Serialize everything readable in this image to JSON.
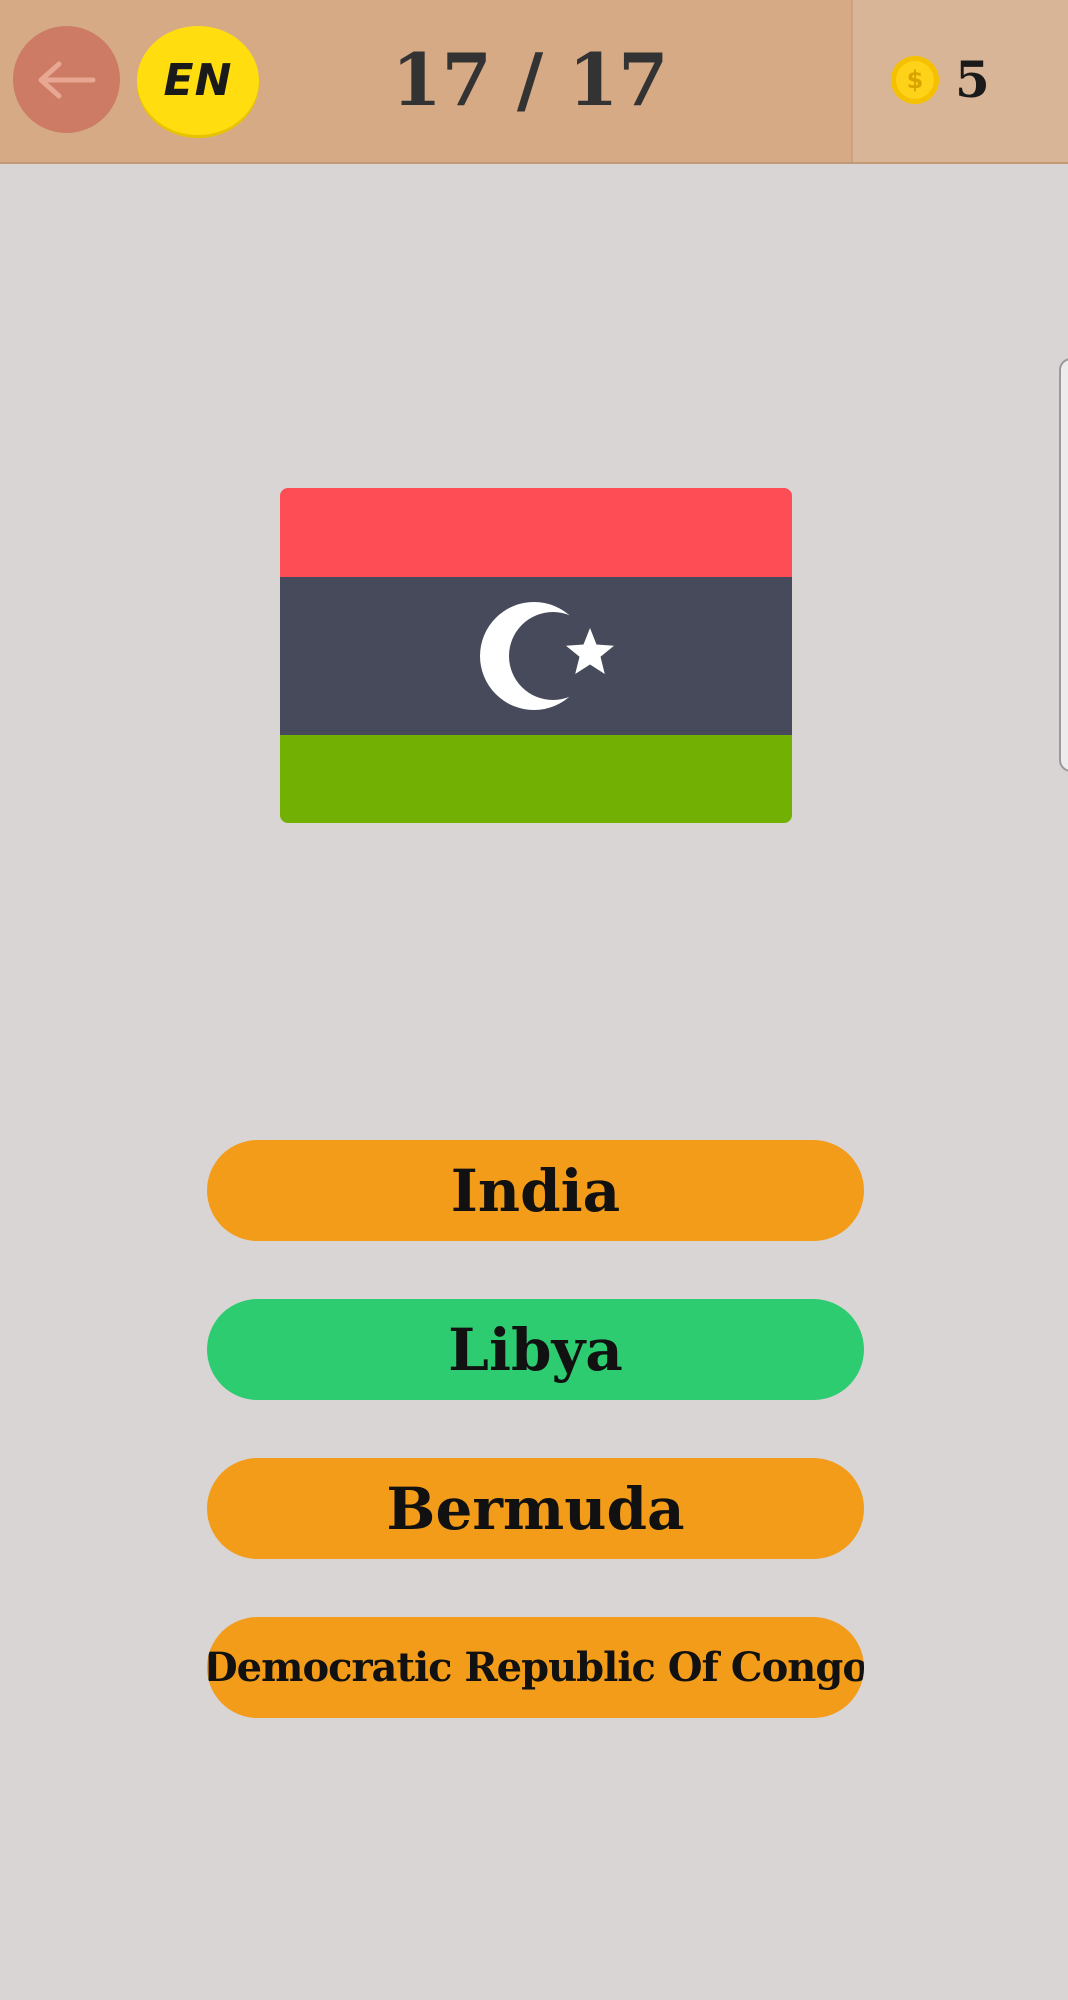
{
  "header": {
    "language_label": "EN",
    "progress": "17 / 17",
    "coins": "5",
    "coin_symbol": "$"
  },
  "question": {
    "flag_icon": "libya-flag-icon",
    "flag_colors": {
      "top": "#ff4d56",
      "middle": "#474a5a",
      "bottom": "#73b004",
      "emblem": "#ffffff"
    }
  },
  "answers": [
    {
      "label": "India",
      "state": "default"
    },
    {
      "label": "Libya",
      "state": "correct"
    },
    {
      "label": "Bermuda",
      "state": "default"
    },
    {
      "label": "Democratic Republic Of Congo",
      "state": "default"
    }
  ],
  "colors": {
    "header_bg": "#d5aa85",
    "option_default": "#f39c1a",
    "option_correct": "#2ecc71",
    "page_bg": "#d9d5d5"
  }
}
